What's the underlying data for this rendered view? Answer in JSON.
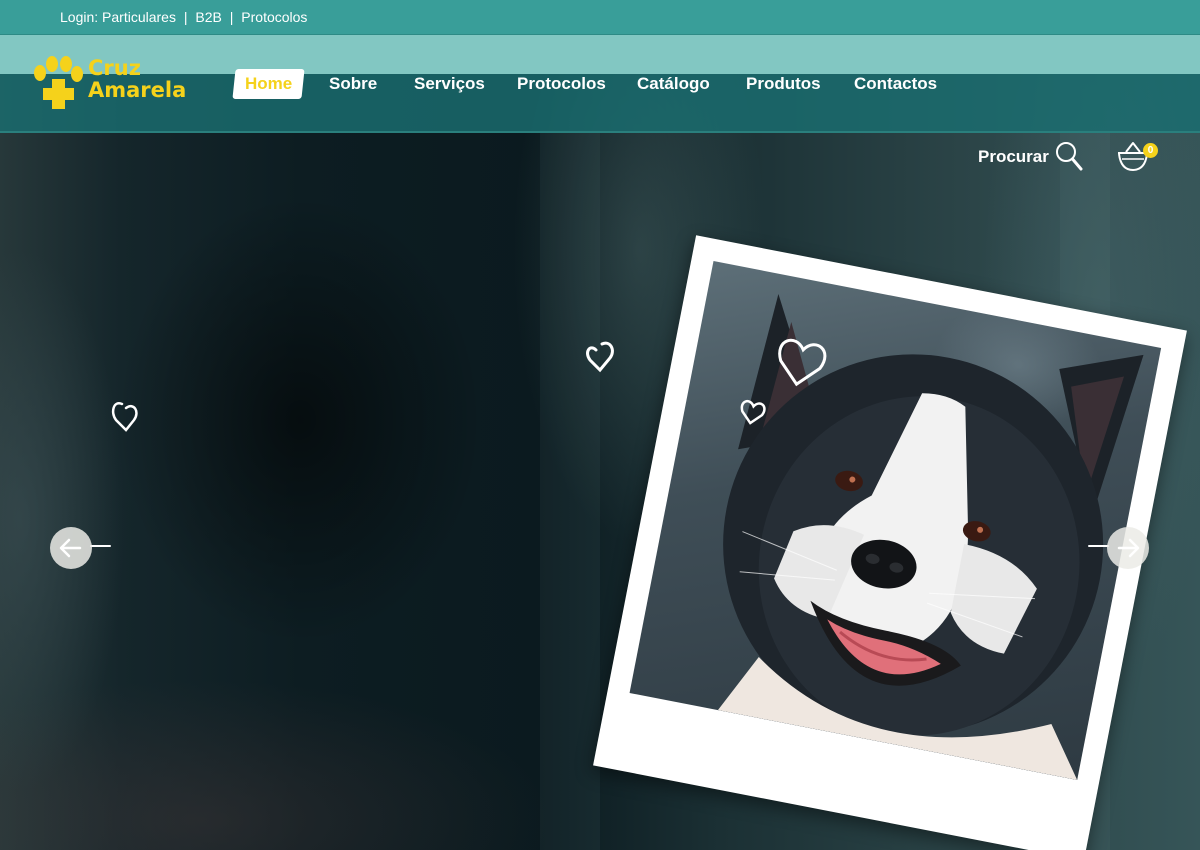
{
  "topbar": {
    "prefix": "Login:",
    "links": [
      "Particulares",
      "B2B",
      "Protocolos"
    ],
    "separator": "|"
  },
  "brand": {
    "name_line1": "Cruz",
    "name_line2": "Amarela",
    "icon": "paw-cross-logo-icon",
    "color": "#f5d21b"
  },
  "nav": {
    "items": [
      {
        "label": "Home",
        "active": true
      },
      {
        "label": "Sobre",
        "active": false
      },
      {
        "label": "Serviços",
        "active": false
      },
      {
        "label": "Protocolos",
        "active": false
      },
      {
        "label": "Catálogo",
        "active": false
      },
      {
        "label": "Produtos",
        "active": false
      },
      {
        "label": "Contactos",
        "active": false
      }
    ]
  },
  "search": {
    "label": "Procurar",
    "icon": "magnifier-icon"
  },
  "cart": {
    "icon": "basket-icon",
    "count": "0"
  },
  "slider": {
    "prev_icon": "arrow-left-icon",
    "next_icon": "arrow-right-icon"
  },
  "colors": {
    "topbar": "#399e99",
    "header_light": "#82c7c2",
    "header_dark": "#1a6e70",
    "accent_yellow": "#f5d21b",
    "white": "#ffffff"
  }
}
